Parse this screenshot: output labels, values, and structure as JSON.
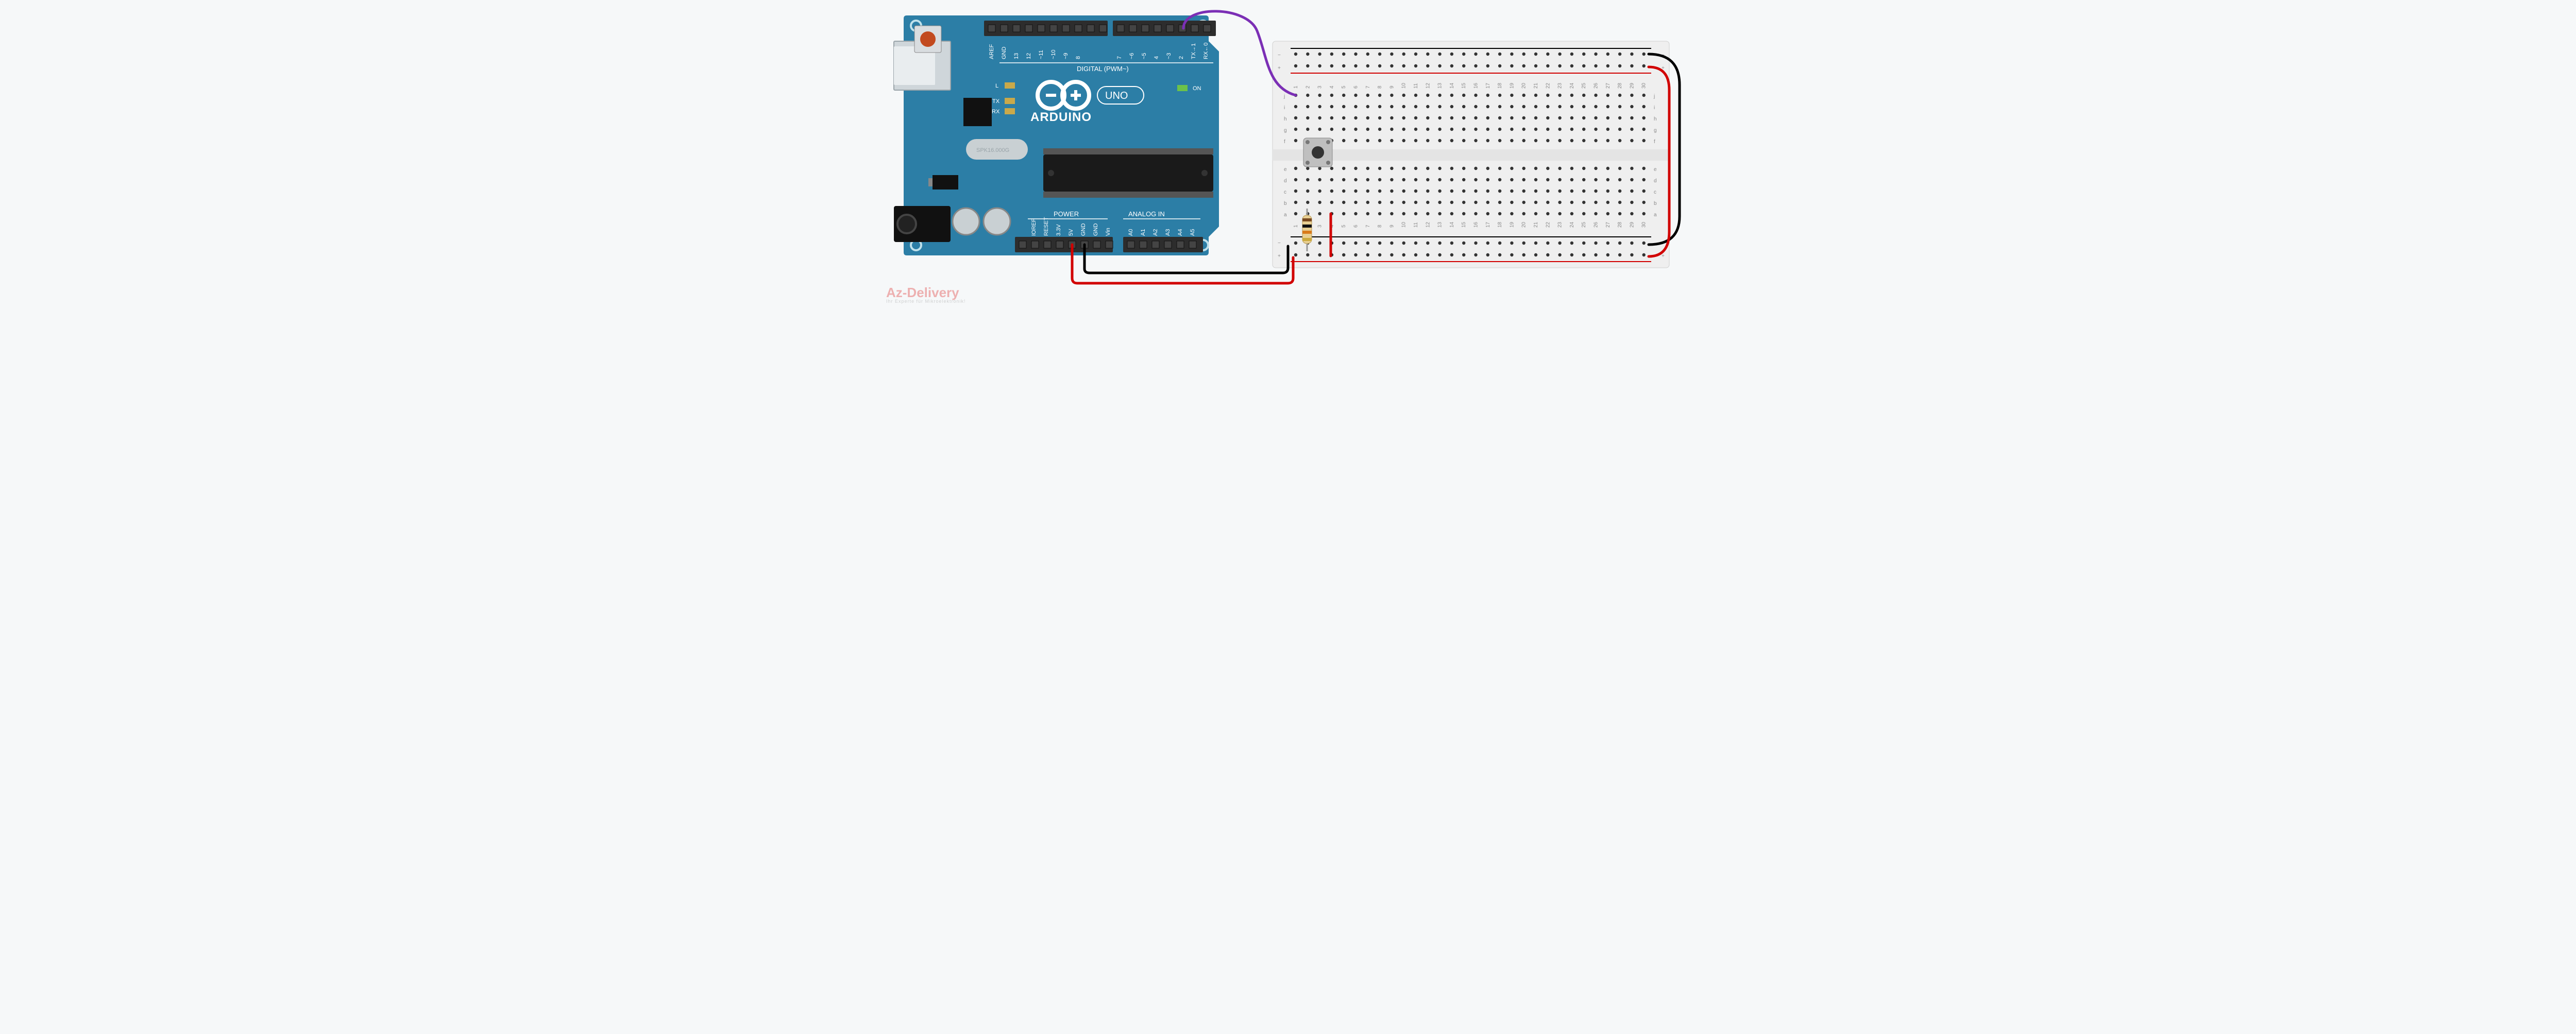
{
  "board": {
    "name": "Arduino UNO",
    "logo_text": "ARDUINO",
    "variant": "UNO",
    "crystal": "SPK16.000G",
    "sections": {
      "digital": "DIGITAL (PWM~)",
      "power": "POWER",
      "analog": "ANALOG IN"
    },
    "leds": {
      "l": "L",
      "tx": "TX",
      "rx": "RX",
      "on": "ON"
    },
    "pins_top": [
      "AREF",
      "GND",
      "13",
      "12",
      "~11",
      "~10",
      "~9",
      "8",
      "7",
      "~6",
      "~5",
      "4",
      "~3",
      "2",
      "TX→1",
      "RX←0"
    ],
    "pins_power": [
      "IOREF",
      "RESET",
      "3.3V",
      "5V",
      "GND",
      "GND",
      "Vin"
    ],
    "pins_analog": [
      "A0",
      "A1",
      "A2",
      "A3",
      "A4",
      "A5"
    ]
  },
  "breadboard": {
    "columns": 30,
    "row_labels_top": [
      "j",
      "i",
      "h",
      "g",
      "f"
    ],
    "row_labels_bot": [
      "e",
      "d",
      "c",
      "b",
      "a"
    ],
    "rail_plus": "+",
    "rail_minus": "−"
  },
  "components": {
    "button": {
      "type": "tact-switch",
      "position": {
        "cols": [
          2,
          4
        ],
        "rows": [
          "e",
          "f"
        ]
      },
      "color": "#555"
    },
    "resistor": {
      "type": "resistor",
      "value_ohms": 10000,
      "bands": [
        "brown",
        "black",
        "orange",
        "gold"
      ],
      "position": {
        "col": 2,
        "from": "a",
        "to": "bottom-rail-"
      }
    }
  },
  "wires": [
    {
      "color": "purple",
      "from": {
        "board": "arduino",
        "pin": "D2"
      },
      "to": {
        "board": "breadboard",
        "row": "j",
        "col": 1
      }
    },
    {
      "color": "red",
      "from": {
        "board": "arduino",
        "pin": "5V"
      },
      "to": {
        "board": "breadboard",
        "rail": "bottom+",
        "col": 1
      }
    },
    {
      "color": "black",
      "from": {
        "board": "arduino",
        "pin": "GND"
      },
      "to": {
        "board": "breadboard",
        "rail": "bottom-",
        "col": 1
      }
    },
    {
      "color": "red",
      "from": {
        "board": "breadboard",
        "rail": "bottom+",
        "col": 4
      },
      "to": {
        "board": "breadboard",
        "row": "a",
        "col": 4
      }
    },
    {
      "color": "red",
      "from": {
        "board": "breadboard",
        "rail": "top+",
        "col": 30
      },
      "to": {
        "board": "breadboard",
        "rail": "bottom+",
        "col": 30
      }
    },
    {
      "color": "black",
      "from": {
        "board": "breadboard",
        "rail": "top-",
        "col": 30
      },
      "to": {
        "board": "breadboard",
        "rail": "bottom-",
        "col": 30
      }
    }
  ],
  "brand": {
    "name": "Az-Delivery",
    "tagline": "Ihr Experte für Mikroelektronik!"
  }
}
